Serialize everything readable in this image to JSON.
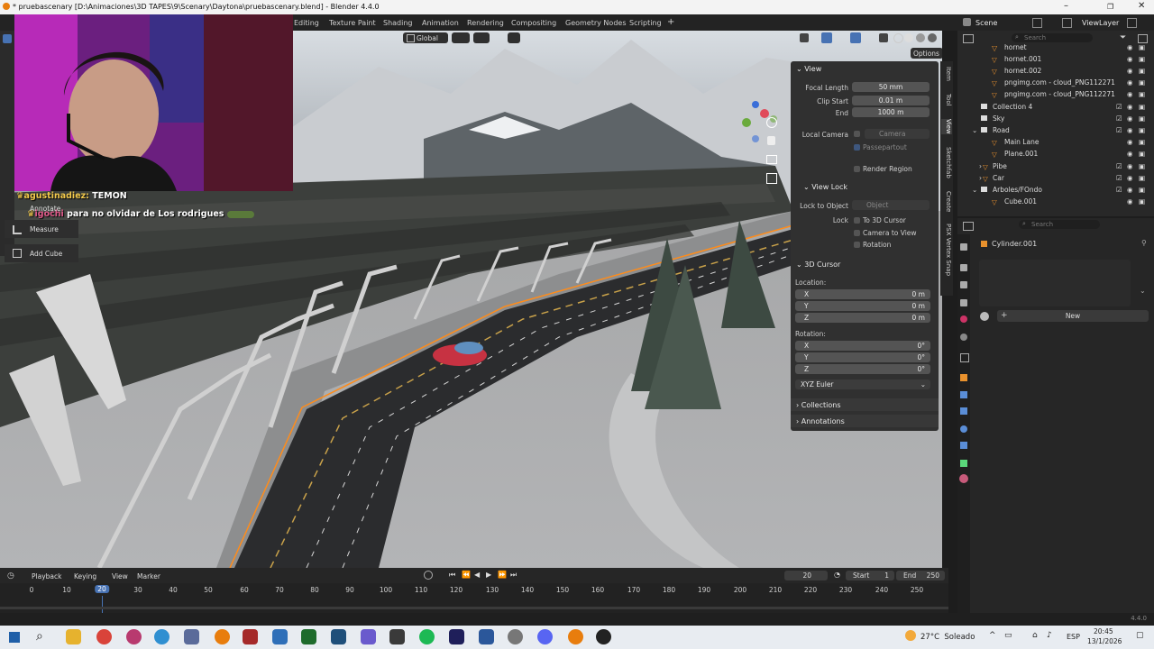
{
  "window": {
    "title": "* pruebascenary [D:\\Animaciones\\3D TAPES\\9\\Scenary\\Daytona\\pruebascenary.blend] - Blender 4.4.0"
  },
  "workspaces": [
    "Editing",
    "Texture Paint",
    "Shading",
    "Animation",
    "Rendering",
    "Compositing",
    "Geometry Nodes",
    "Scripting",
    "+"
  ],
  "scene": {
    "name": "Scene",
    "view_layer": "ViewLayer"
  },
  "viewport_header": {
    "orientation": "Global",
    "options": "Options"
  },
  "npanel": {
    "view": {
      "header": "View",
      "focal_length_label": "Focal Length",
      "focal_length": "50 mm",
      "clip_start_label": "Clip Start",
      "clip_start": "0.01 m",
      "end_label": "End",
      "end": "1000 m",
      "local_camera_label": "Local Camera",
      "camera": "Camera",
      "passepartout": "Passepartout",
      "render_region": "Render Region"
    },
    "view_lock": {
      "header": "View Lock",
      "lock_to_object_label": "Lock to Object",
      "object_placeholder": "Object",
      "lock_label": "Lock",
      "to_3d_cursor": "To 3D Cursor",
      "camera_to_view": "Camera to View",
      "rotation": "Rotation"
    },
    "cursor": {
      "header": "3D Cursor",
      "location_label": "Location:",
      "x_label": "X",
      "x": "0 m",
      "y_label": "Y",
      "y": "0 m",
      "z_label": "Z",
      "z": "0 m",
      "rotation_label": "Rotation:",
      "rx": "0°",
      "ry": "0°",
      "rz": "0°",
      "mode": "XYZ Euler"
    },
    "collections": "Collections",
    "annotations": "Annotations",
    "tabs": [
      "Item",
      "Tool",
      "View",
      "Sketchfab",
      "Create",
      "PSX Vertex Snap"
    ]
  },
  "outliner": {
    "search_placeholder": "Search",
    "rows": [
      {
        "name": "hornet"
      },
      {
        "name": "hornet.001"
      },
      {
        "name": "hornet.002"
      },
      {
        "name": "pngimg.com - cloud_PNG112271"
      },
      {
        "name": "pngimg.com - cloud_PNG112271"
      },
      {
        "name": "Collection 4"
      },
      {
        "name": "Sky"
      },
      {
        "name": "Road"
      },
      {
        "name": "Main Lane"
      },
      {
        "name": "Plane.001"
      },
      {
        "name": "Pibe"
      },
      {
        "name": "Car"
      },
      {
        "name": "Arboles/FOndo"
      },
      {
        "name": "Cube.001"
      }
    ]
  },
  "properties": {
    "search_placeholder": "Search",
    "object_name": "Cylinder.001",
    "new_button": "New"
  },
  "toolbar": {
    "annotate": "Annotate",
    "measure": "Measure",
    "add_cube": "Add Cube"
  },
  "chat": [
    {
      "user": "agustinadiez:",
      "message": "TEMON"
    },
    {
      "user": "igochi",
      "message": "para no olvidar de Los rodrigues"
    }
  ],
  "timeline": {
    "menus": [
      "Playback",
      "Keying",
      "View",
      "Marker"
    ],
    "current_frame": "20",
    "start_label": "Start",
    "start": "1",
    "end_label": "End",
    "end": "250",
    "ticks": [
      "0",
      "10",
      "20",
      "30",
      "40",
      "50",
      "60",
      "70",
      "80",
      "90",
      "100",
      "110",
      "120",
      "130",
      "140",
      "150",
      "160",
      "170",
      "180",
      "190",
      "200",
      "210",
      "220",
      "230",
      "240",
      "250"
    ]
  },
  "statusbar": {
    "version": "4.4.0"
  },
  "taskbar": {
    "weather": "27°C  Soleado",
    "lang": "ESP",
    "time": "20:45",
    "date": "13/1/2026"
  },
  "colors": {
    "accent_blue": "#4772b3",
    "selection_orange": "#ff8c1a",
    "panel_bg": "#303030"
  }
}
